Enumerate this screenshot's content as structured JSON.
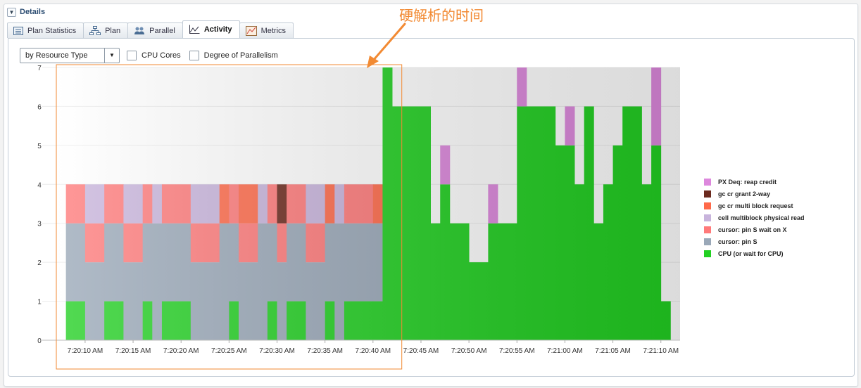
{
  "details": {
    "title": "Details"
  },
  "tabs": [
    {
      "label": "Plan Statistics",
      "icon": "plan-statistics-icon"
    },
    {
      "label": "Plan",
      "icon": "plan-tree-icon"
    },
    {
      "label": "Parallel",
      "icon": "parallel-icon"
    },
    {
      "label": "Activity",
      "icon": "activity-chart-icon",
      "active": true
    },
    {
      "label": "Metrics",
      "icon": "metrics-icon"
    }
  ],
  "toolbar": {
    "dimension_select": "by Resource Type",
    "cpu_cores_label": "CPU Cores",
    "cpu_cores_checked": false,
    "dop_label": "Degree of Parallelism",
    "dop_checked": false
  },
  "annotation": {
    "text": "硬解析的时间",
    "color": "#f28a33"
  },
  "chart_data": {
    "type": "area",
    "stacked": true,
    "ylim": [
      0,
      7
    ],
    "y_ticks": [
      0,
      1,
      2,
      3,
      4,
      5,
      6,
      7
    ],
    "xlim": [
      "7:20:07",
      "7:21:12"
    ],
    "x_ticks": [
      "7:20:10 AM",
      "7:20:15 AM",
      "7:20:20 AM",
      "7:20:25 AM",
      "7:20:30 AM",
      "7:20:35 AM",
      "7:20:40 AM",
      "7:20:45 AM",
      "7:20:50 AM",
      "7:20:55 AM",
      "7:21:00 AM",
      "7:21:05 AM",
      "7:21:10 AM"
    ],
    "highlight_range": [
      "7:20:07",
      "7:20:43"
    ],
    "grid": true,
    "legend_position": "right",
    "series": [
      {
        "name": "PX Deq: reap credit",
        "color": "#dd88dd"
      },
      {
        "name": "gc cr grant 2-way",
        "color": "#6b2a1e"
      },
      {
        "name": "gc cr multi block request",
        "color": "#ff6a4a"
      },
      {
        "name": "cell multiblock physical read",
        "color": "#c8b4dc"
      },
      {
        "name": "cursor: pin S wait on X",
        "color": "#ff7a7a"
      },
      {
        "name": "cursor: pin S",
        "color": "#9aa8b8"
      },
      {
        "name": "CPU (or wait for CPU)",
        "color": "#22d022"
      }
    ],
    "timeline": [
      {
        "start": "7:20:08",
        "end": "7:20:10",
        "layers": [
          [
            "CPU (or wait for CPU)",
            1
          ],
          [
            "cursor: pin S",
            2
          ],
          [
            "cursor: pin S wait on X",
            1
          ]
        ]
      },
      {
        "start": "7:20:10",
        "end": "7:20:12",
        "layers": [
          [
            "cursor: pin S",
            2
          ],
          [
            "cursor: pin S wait on X",
            1
          ],
          [
            "cell multiblock physical read",
            1
          ]
        ]
      },
      {
        "start": "7:20:12",
        "end": "7:20:14",
        "layers": [
          [
            "CPU (or wait for CPU)",
            1
          ],
          [
            "cursor: pin S",
            2
          ],
          [
            "cursor: pin S wait on X",
            1
          ]
        ]
      },
      {
        "start": "7:20:14",
        "end": "7:20:16",
        "layers": [
          [
            "cursor: pin S",
            2
          ],
          [
            "cursor: pin S wait on X",
            1
          ],
          [
            "cell multiblock physical read",
            1
          ]
        ]
      },
      {
        "start": "7:20:16",
        "end": "7:20:17",
        "layers": [
          [
            "CPU (or wait for CPU)",
            1
          ],
          [
            "cursor: pin S",
            2
          ],
          [
            "cursor: pin S wait on X",
            1
          ]
        ]
      },
      {
        "start": "7:20:17",
        "end": "7:20:18",
        "layers": [
          [
            "cursor: pin S",
            3
          ],
          [
            "cell multiblock physical read",
            1
          ]
        ]
      },
      {
        "start": "7:20:18",
        "end": "7:20:21",
        "layers": [
          [
            "CPU (or wait for CPU)",
            1
          ],
          [
            "cursor: pin S",
            2
          ],
          [
            "cursor: pin S wait on X",
            1
          ]
        ]
      },
      {
        "start": "7:20:21",
        "end": "7:20:24",
        "layers": [
          [
            "cursor: pin S",
            2
          ],
          [
            "cursor: pin S wait on X",
            1
          ],
          [
            "cell multiblock physical read",
            1
          ]
        ]
      },
      {
        "start": "7:20:24",
        "end": "7:20:25",
        "layers": [
          [
            "cursor: pin S",
            3
          ],
          [
            "gc cr multi block request",
            1
          ]
        ]
      },
      {
        "start": "7:20:25",
        "end": "7:20:26",
        "layers": [
          [
            "CPU (or wait for CPU)",
            1
          ],
          [
            "cursor: pin S",
            2
          ],
          [
            "cursor: pin S wait on X",
            1
          ]
        ]
      },
      {
        "start": "7:20:26",
        "end": "7:20:28",
        "layers": [
          [
            "cursor: pin S",
            2
          ],
          [
            "cursor: pin S wait on X",
            1
          ],
          [
            "gc cr multi block request",
            1
          ]
        ]
      },
      {
        "start": "7:20:28",
        "end": "7:20:29",
        "layers": [
          [
            "cursor: pin S",
            3
          ],
          [
            "cell multiblock physical read",
            1
          ]
        ]
      },
      {
        "start": "7:20:29",
        "end": "7:20:30",
        "layers": [
          [
            "CPU (or wait for CPU)",
            1
          ],
          [
            "cursor: pin S",
            2
          ],
          [
            "cursor: pin S wait on X",
            1
          ]
        ]
      },
      {
        "start": "7:20:30",
        "end": "7:20:31",
        "layers": [
          [
            "cursor: pin S",
            2
          ],
          [
            "cursor: pin S wait on X",
            1
          ],
          [
            "gc cr grant 2-way",
            1
          ]
        ]
      },
      {
        "start": "7:20:31",
        "end": "7:20:33",
        "layers": [
          [
            "CPU (or wait for CPU)",
            1
          ],
          [
            "cursor: pin S",
            2
          ],
          [
            "cursor: pin S wait on X",
            1
          ]
        ]
      },
      {
        "start": "7:20:33",
        "end": "7:20:35",
        "layers": [
          [
            "cursor: pin S",
            2
          ],
          [
            "cursor: pin S wait on X",
            1
          ],
          [
            "cell multiblock physical read",
            1
          ]
        ]
      },
      {
        "start": "7:20:35",
        "end": "7:20:36",
        "layers": [
          [
            "CPU (or wait for CPU)",
            1
          ],
          [
            "cursor: pin S",
            2
          ],
          [
            "gc cr multi block request",
            1
          ]
        ]
      },
      {
        "start": "7:20:36",
        "end": "7:20:37",
        "layers": [
          [
            "cursor: pin S",
            3
          ],
          [
            "cell multiblock physical read",
            1
          ]
        ]
      },
      {
        "start": "7:20:37",
        "end": "7:20:40",
        "layers": [
          [
            "CPU (or wait for CPU)",
            1
          ],
          [
            "cursor: pin S",
            2
          ],
          [
            "cursor: pin S wait on X",
            1
          ]
        ]
      },
      {
        "start": "7:20:40",
        "end": "7:20:41",
        "layers": [
          [
            "CPU (or wait for CPU)",
            1
          ],
          [
            "cursor: pin S",
            2
          ],
          [
            "gc cr multi block request",
            1
          ]
        ]
      },
      {
        "start": "7:20:41",
        "end": "7:20:42",
        "layers": [
          [
            "CPU (or wait for CPU)",
            7
          ]
        ]
      },
      {
        "start": "7:20:42",
        "end": "7:20:46",
        "layers": [
          [
            "CPU (or wait for CPU)",
            6
          ]
        ]
      },
      {
        "start": "7:20:46",
        "end": "7:20:47",
        "layers": [
          [
            "CPU (or wait for CPU)",
            3
          ]
        ]
      },
      {
        "start": "7:20:47",
        "end": "7:20:48",
        "layers": [
          [
            "CPU (or wait for CPU)",
            4
          ],
          [
            "PX Deq: reap credit",
            1
          ]
        ]
      },
      {
        "start": "7:20:48",
        "end": "7:20:50",
        "layers": [
          [
            "CPU (or wait for CPU)",
            3
          ]
        ]
      },
      {
        "start": "7:20:50",
        "end": "7:20:52",
        "layers": [
          [
            "CPU (or wait for CPU)",
            2
          ]
        ]
      },
      {
        "start": "7:20:52",
        "end": "7:20:53",
        "layers": [
          [
            "CPU (or wait for CPU)",
            3
          ],
          [
            "PX Deq: reap credit",
            1
          ]
        ]
      },
      {
        "start": "7:20:53",
        "end": "7:20:55",
        "layers": [
          [
            "CPU (or wait for CPU)",
            3
          ]
        ]
      },
      {
        "start": "7:20:55",
        "end": "7:20:56",
        "layers": [
          [
            "CPU (or wait for CPU)",
            6
          ],
          [
            "PX Deq: reap credit",
            1
          ]
        ]
      },
      {
        "start": "7:20:56",
        "end": "7:20:59",
        "layers": [
          [
            "CPU (or wait for CPU)",
            6
          ]
        ]
      },
      {
        "start": "7:20:59",
        "end": "7:21:00",
        "layers": [
          [
            "CPU (or wait for CPU)",
            5
          ]
        ]
      },
      {
        "start": "7:21:00",
        "end": "7:21:01",
        "layers": [
          [
            "CPU (or wait for CPU)",
            5
          ],
          [
            "PX Deq: reap credit",
            1
          ]
        ]
      },
      {
        "start": "7:21:01",
        "end": "7:21:02",
        "layers": [
          [
            "CPU (or wait for CPU)",
            4
          ]
        ]
      },
      {
        "start": "7:21:02",
        "end": "7:21:03",
        "layers": [
          [
            "CPU (or wait for CPU)",
            6
          ]
        ]
      },
      {
        "start": "7:21:03",
        "end": "7:21:04",
        "layers": [
          [
            "CPU (or wait for CPU)",
            3
          ]
        ]
      },
      {
        "start": "7:21:04",
        "end": "7:21:05",
        "layers": [
          [
            "CPU (or wait for CPU)",
            4
          ]
        ]
      },
      {
        "start": "7:21:05",
        "end": "7:21:06",
        "layers": [
          [
            "CPU (or wait for CPU)",
            5
          ]
        ]
      },
      {
        "start": "7:21:06",
        "end": "7:21:08",
        "layers": [
          [
            "CPU (or wait for CPU)",
            6
          ]
        ]
      },
      {
        "start": "7:21:08",
        "end": "7:21:09",
        "layers": [
          [
            "CPU (or wait for CPU)",
            4
          ]
        ]
      },
      {
        "start": "7:21:09",
        "end": "7:21:10",
        "layers": [
          [
            "CPU (or wait for CPU)",
            5
          ],
          [
            "PX Deq: reap credit",
            2
          ]
        ]
      },
      {
        "start": "7:21:10",
        "end": "7:21:11",
        "layers": [
          [
            "CPU (or wait for CPU)",
            1
          ]
        ]
      }
    ]
  }
}
